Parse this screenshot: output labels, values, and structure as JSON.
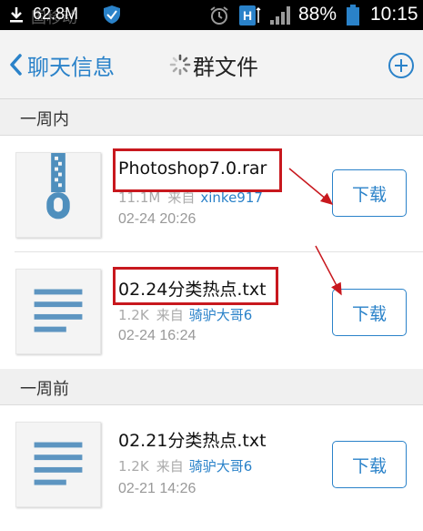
{
  "status_bar": {
    "carrier": "国移动",
    "memory": "62.8M",
    "battery": "88%",
    "time": "10:15"
  },
  "header": {
    "back_label": "聊天信息",
    "title": "群文件"
  },
  "sections": [
    {
      "label": "一周内",
      "files": [
        {
          "name": "Photoshop7.0.rar",
          "size": "11.1M",
          "from_label": "来自",
          "sender": "xinke917",
          "date": "02-24 20:26",
          "icon": "archive-zip-icon",
          "download_label": "下载"
        },
        {
          "name": "02.24分类热点.txt",
          "size": "1.2K",
          "from_label": "来自",
          "sender": "骑驴大哥6",
          "date": "02-24 16:24",
          "icon": "text-file-icon",
          "download_label": "下载"
        }
      ]
    },
    {
      "label": "一周前",
      "files": [
        {
          "name": "02.21分类热点.txt",
          "size": "1.2K",
          "from_label": "来自",
          "sender": "骑驴大哥6",
          "date": "02-21 14:26",
          "icon": "text-file-icon",
          "download_label": "下载"
        }
      ]
    }
  ],
  "colors": {
    "accent": "#2a82c9",
    "annotation": "#c8181e"
  }
}
